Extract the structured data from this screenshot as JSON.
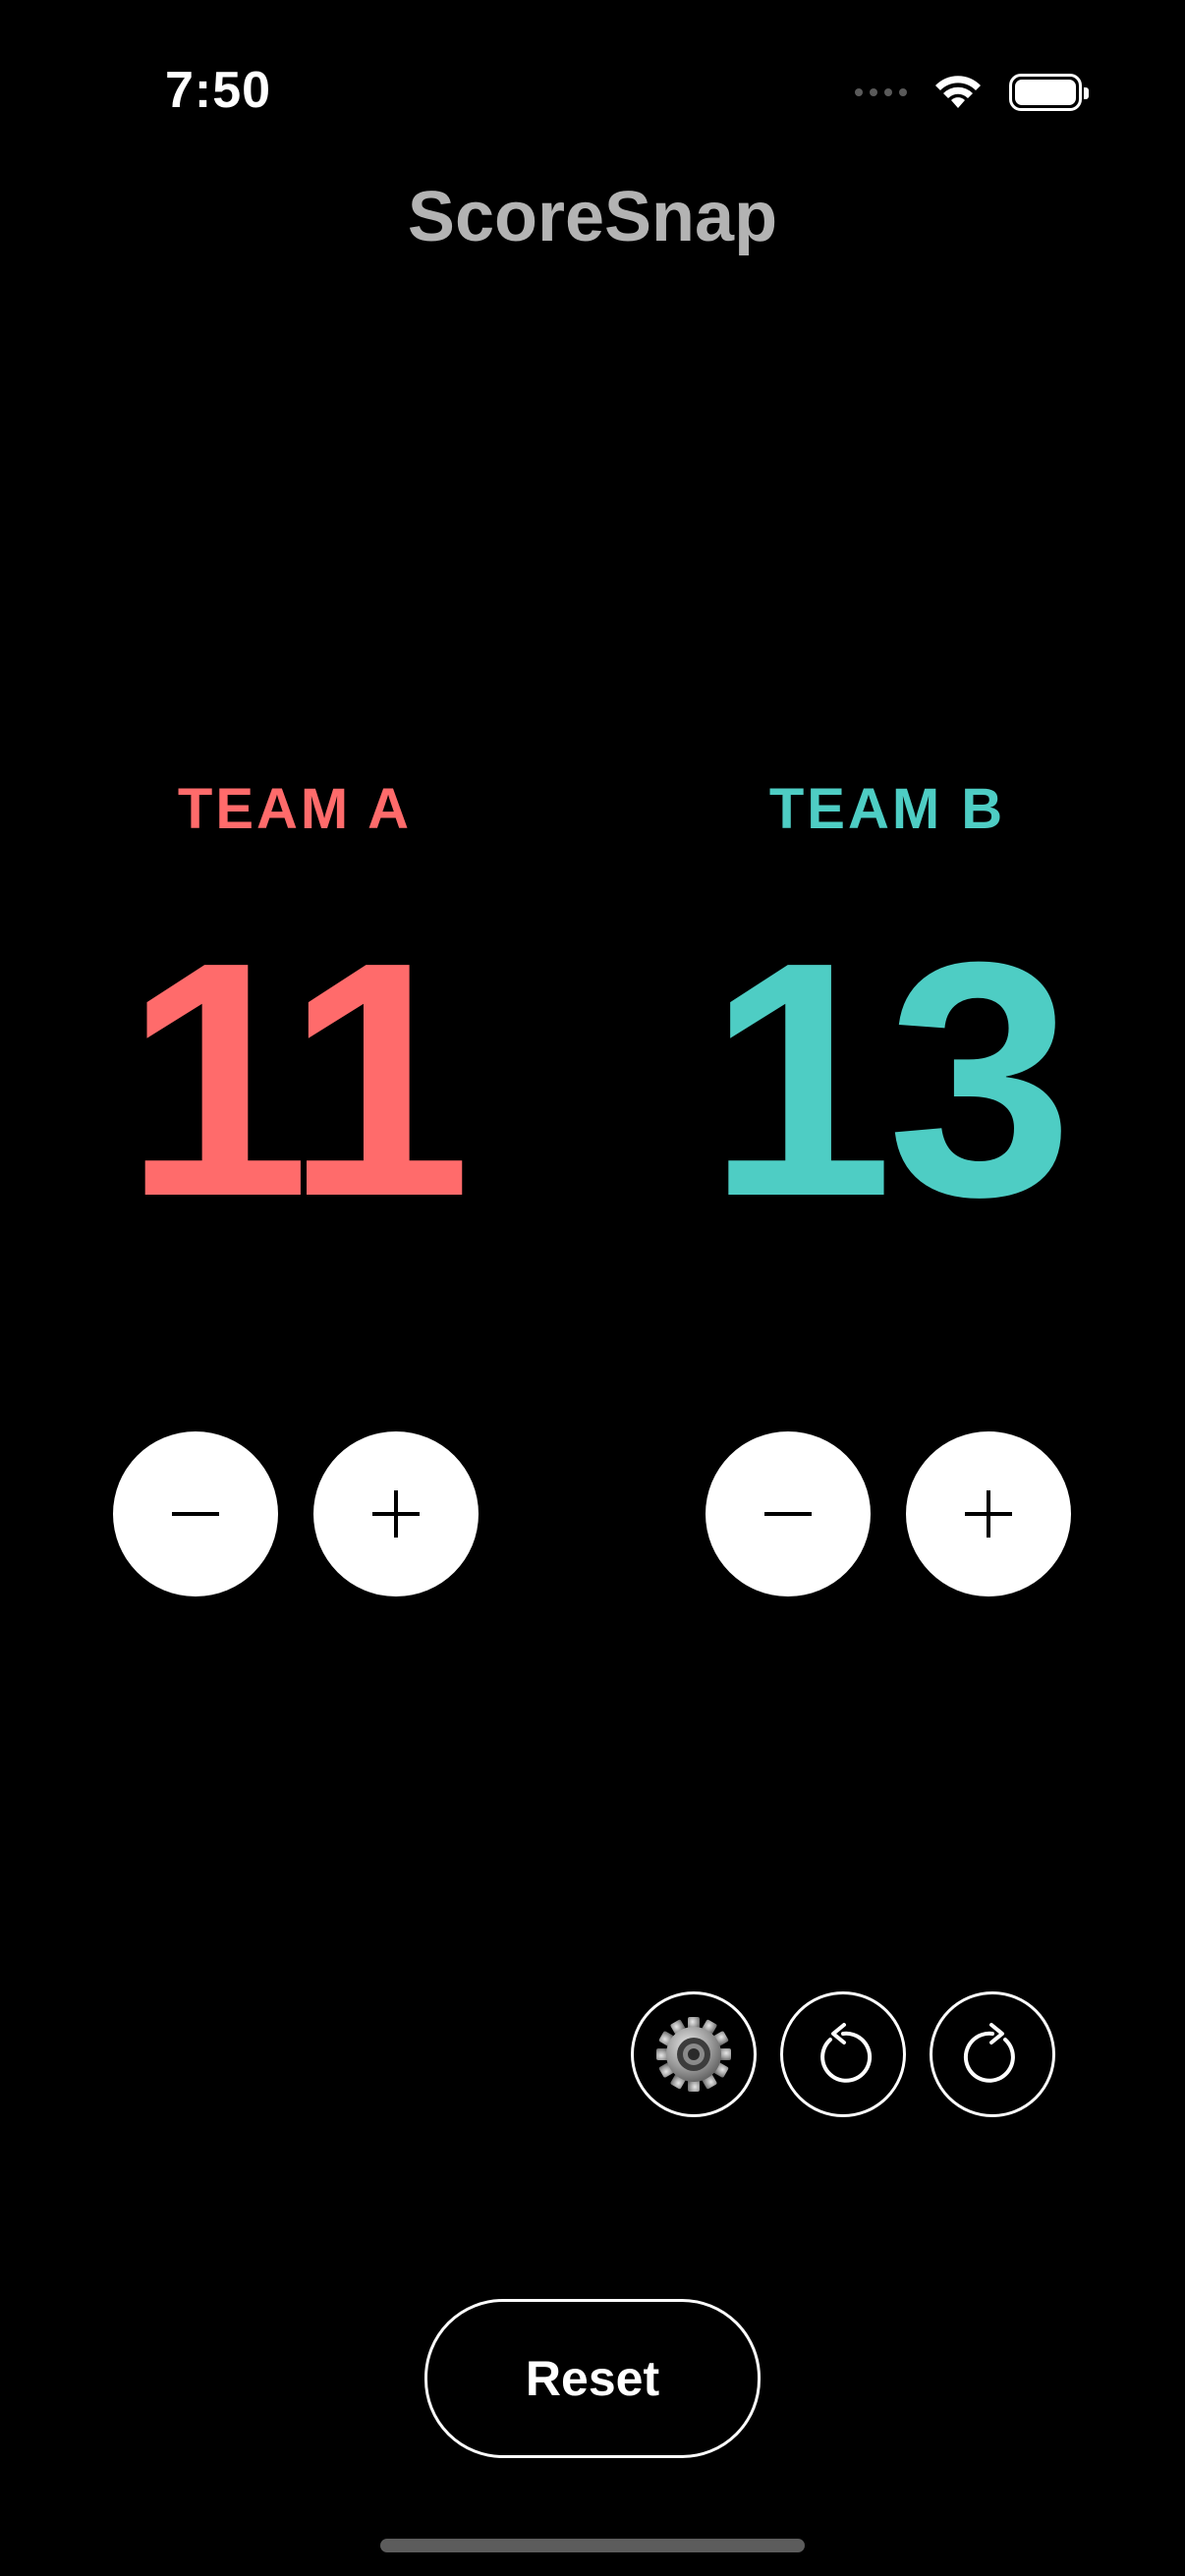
{
  "status_bar": {
    "time": "7:50",
    "icons": [
      "cellular-signal-icon",
      "wifi-icon",
      "battery-icon"
    ]
  },
  "app": {
    "title": "ScoreSnap"
  },
  "teams": [
    {
      "label": "TEAM A",
      "score": "11",
      "color": "#ff6b6b"
    },
    {
      "label": "TEAM B",
      "score": "13",
      "color": "#4ecdc4"
    }
  ],
  "controls": {
    "decrement_icon": "minus-icon",
    "increment_icon": "plus-icon",
    "tools": [
      "gear-icon",
      "undo-icon",
      "redo-icon"
    ],
    "reset_label": "Reset"
  },
  "colors": {
    "background": "#000000",
    "title": "#b3b3b3",
    "button": "#ffffff"
  }
}
